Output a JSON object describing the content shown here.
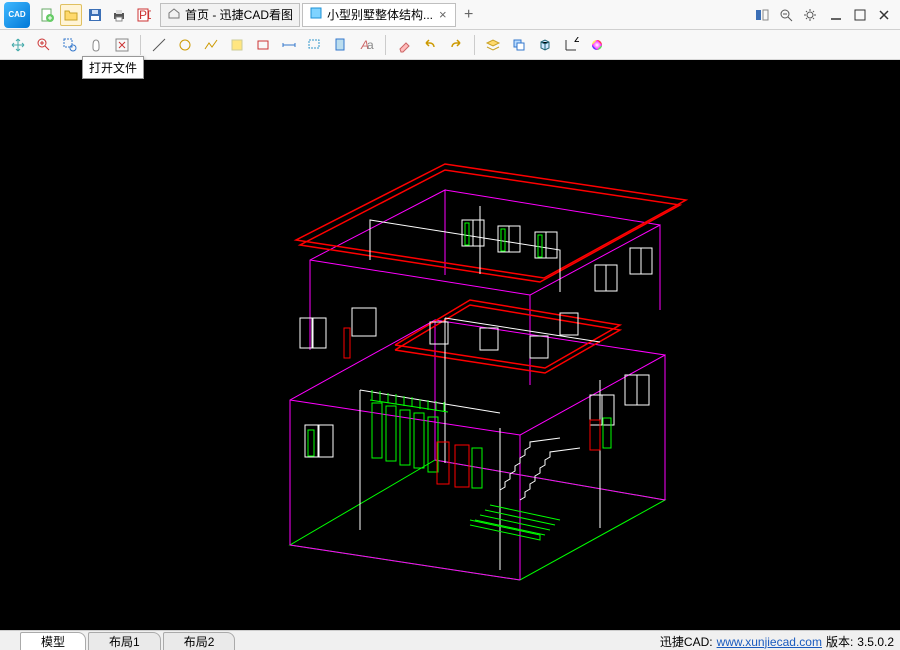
{
  "app": {
    "logoText": "CAD"
  },
  "titlebar_icons": {
    "new": "new-file",
    "open": "open-file",
    "save": "save",
    "print": "print",
    "pdf": "pdf"
  },
  "tabs": [
    {
      "icon": "home",
      "title": "首页 - 迅捷CAD看图",
      "active": false,
      "closable": false
    },
    {
      "icon": "doc",
      "title": "小型别墅整体结构...",
      "active": true,
      "closable": true
    }
  ],
  "tooltip": "打开文件",
  "window_icons": [
    "panel-toggle",
    "zoom-out",
    "settings"
  ],
  "bottom_tabs": [
    {
      "label": "模型",
      "active": true
    },
    {
      "label": "布局1",
      "active": false
    },
    {
      "label": "布局2",
      "active": false
    }
  ],
  "status": {
    "product": "迅捷CAD:",
    "link": "www.xunjiecad.com",
    "version_label": "版本:",
    "version": "3.5.0.2"
  },
  "toolbar_groups": [
    [
      "move-icon",
      "zoom-region-icon",
      "zoom-window-icon",
      "pan-icon",
      "zoom-extents-icon"
    ],
    [
      "line-icon",
      "circle-icon",
      "polyline-icon",
      "highlight-icon",
      "rect-icon",
      "dim-icon",
      "leader-icon",
      "layer-icon",
      "text-icon"
    ],
    [
      "erase-icon",
      "undo-icon",
      "redo-icon"
    ],
    [
      "layers-icon",
      "copy-stack-icon",
      "3d-cube-icon",
      "axis-icon",
      "color-wheel-icon"
    ]
  ]
}
